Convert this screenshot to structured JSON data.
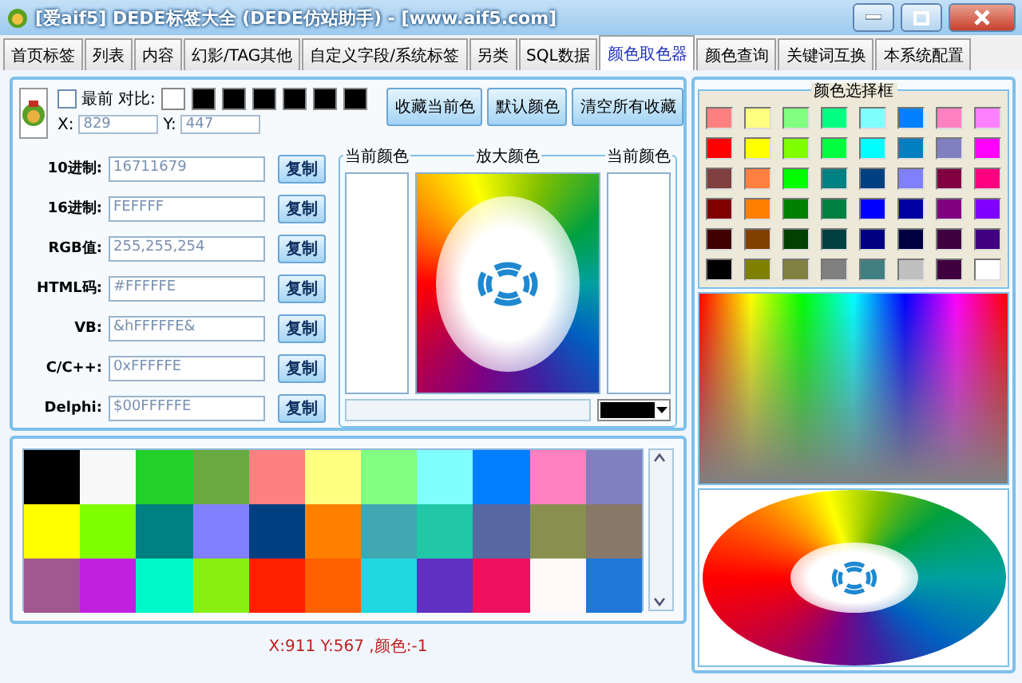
{
  "window": {
    "title": "[爱aif5] DEDE标签大全 (DEDE仿站助手) - [www.aif5.com]"
  },
  "tabs": [
    {
      "label": "首页标签",
      "selected": false
    },
    {
      "label": "列表",
      "selected": false
    },
    {
      "label": "内容",
      "selected": false
    },
    {
      "label": "幻影/TAG其他",
      "selected": false
    },
    {
      "label": "自定义字段/系统标签",
      "selected": false
    },
    {
      "label": "另类",
      "selected": false
    },
    {
      "label": "SQL数据",
      "selected": false
    },
    {
      "label": "颜色取色器",
      "selected": true
    },
    {
      "label": "颜色查询",
      "selected": false
    },
    {
      "label": "关键词互换",
      "selected": false
    },
    {
      "label": "本系统配置",
      "selected": false
    }
  ],
  "picker": {
    "topmost": {
      "label": "最前",
      "checked": false
    },
    "contrast_label": "对比:",
    "contrast": [
      {
        "color": "#ffffff"
      },
      {
        "color": "#000000"
      },
      {
        "color": "#000000"
      },
      {
        "color": "#000000"
      },
      {
        "color": "#000000"
      },
      {
        "color": "#000000"
      },
      {
        "color": "#000000"
      }
    ],
    "x_label": "X:",
    "x_value": "829",
    "y_label": "Y:",
    "y_value": "447",
    "buttons": [
      "收藏当前色",
      "默认颜色",
      "清空所有收藏"
    ],
    "fields": [
      {
        "label": "10进制:",
        "value": "16711679",
        "button": "复制"
      },
      {
        "label": "16进制:",
        "value": "FEFFFF",
        "button": "复制"
      },
      {
        "label": "RGB值:",
        "value": "255,255,254",
        "button": "复制"
      },
      {
        "label": "HTML码:",
        "value": "#FFFFFE",
        "button": "复制"
      },
      {
        "label": "VB:",
        "value": "&hFFFFFE&",
        "button": "复制"
      },
      {
        "label": "C/C++:",
        "value": "0xFFFFFE",
        "button": "复制"
      },
      {
        "label": "Delphi:",
        "value": "$00FFFFFE",
        "button": "复制"
      }
    ],
    "current_left_label": "当前颜色",
    "magnify_label": "放大颜色",
    "current_right_label": "当前颜色",
    "color_select": {
      "color": "#000000"
    }
  },
  "favorites": [
    {
      "color": "#000000"
    },
    {
      "color": "#f8f8f8"
    },
    {
      "color": "#22d02a"
    },
    {
      "color": "#6aaa40"
    },
    {
      "color": "#ff8080"
    },
    {
      "color": "#ffff80"
    },
    {
      "color": "#80ff80"
    },
    {
      "color": "#80ffff"
    },
    {
      "color": "#0080ff"
    },
    {
      "color": "#ff80c0"
    },
    {
      "color": "#8080c0"
    },
    {
      "color": "#ffff00"
    },
    {
      "color": "#80ff00"
    },
    {
      "color": "#008080"
    },
    {
      "color": "#8080ff"
    },
    {
      "color": "#004080"
    },
    {
      "color": "#ff8000"
    },
    {
      "color": "#40a8b0"
    },
    {
      "color": "#20c8a8"
    },
    {
      "color": "#5868a0"
    },
    {
      "color": "#889050"
    },
    {
      "color": "#887868"
    },
    {
      "color": "#a05890"
    },
    {
      "color": "#c020e0"
    },
    {
      "color": "#00f8c8"
    },
    {
      "color": "#88f010"
    },
    {
      "color": "#ff2000"
    },
    {
      "color": "#ff6000"
    },
    {
      "color": "#20d8e0"
    },
    {
      "color": "#6030c0"
    },
    {
      "color": "#f01060"
    },
    {
      "color": "#fffaf8"
    },
    {
      "color": "#2078d8"
    }
  ],
  "status": "X:911 Y:567 ,颜色:-1",
  "palette": {
    "title": "颜色选择框",
    "swatches": [
      {
        "color": "#ff8080"
      },
      {
        "color": "#ffff80"
      },
      {
        "color": "#80ff80"
      },
      {
        "color": "#00ff80"
      },
      {
        "color": "#80ffff"
      },
      {
        "color": "#0080ff"
      },
      {
        "color": "#ff80c0"
      },
      {
        "color": "#ff80ff"
      },
      {
        "color": "#ff0000"
      },
      {
        "color": "#ffff00"
      },
      {
        "color": "#80ff00"
      },
      {
        "color": "#00ff40"
      },
      {
        "color": "#00ffff"
      },
      {
        "color": "#0080c0"
      },
      {
        "color": "#8080c0"
      },
      {
        "color": "#ff00ff"
      },
      {
        "color": "#804040"
      },
      {
        "color": "#ff8040"
      },
      {
        "color": "#00ff00"
      },
      {
        "color": "#008080"
      },
      {
        "color": "#004080"
      },
      {
        "color": "#8080ff"
      },
      {
        "color": "#800040"
      },
      {
        "color": "#ff0080"
      },
      {
        "color": "#800000"
      },
      {
        "color": "#ff8000"
      },
      {
        "color": "#008000"
      },
      {
        "color": "#008040"
      },
      {
        "color": "#0000ff"
      },
      {
        "color": "#0000a0"
      },
      {
        "color": "#800080"
      },
      {
        "color": "#8000ff"
      },
      {
        "color": "#400000"
      },
      {
        "color": "#804000"
      },
      {
        "color": "#004000"
      },
      {
        "color": "#004040"
      },
      {
        "color": "#000080"
      },
      {
        "color": "#000040"
      },
      {
        "color": "#400040"
      },
      {
        "color": "#400080"
      },
      {
        "color": "#000000"
      },
      {
        "color": "#808000"
      },
      {
        "color": "#808040"
      },
      {
        "color": "#808080"
      },
      {
        "color": "#408080"
      },
      {
        "color": "#c0c0c0"
      },
      {
        "color": "#400040"
      },
      {
        "color": "#ffffff"
      }
    ]
  }
}
